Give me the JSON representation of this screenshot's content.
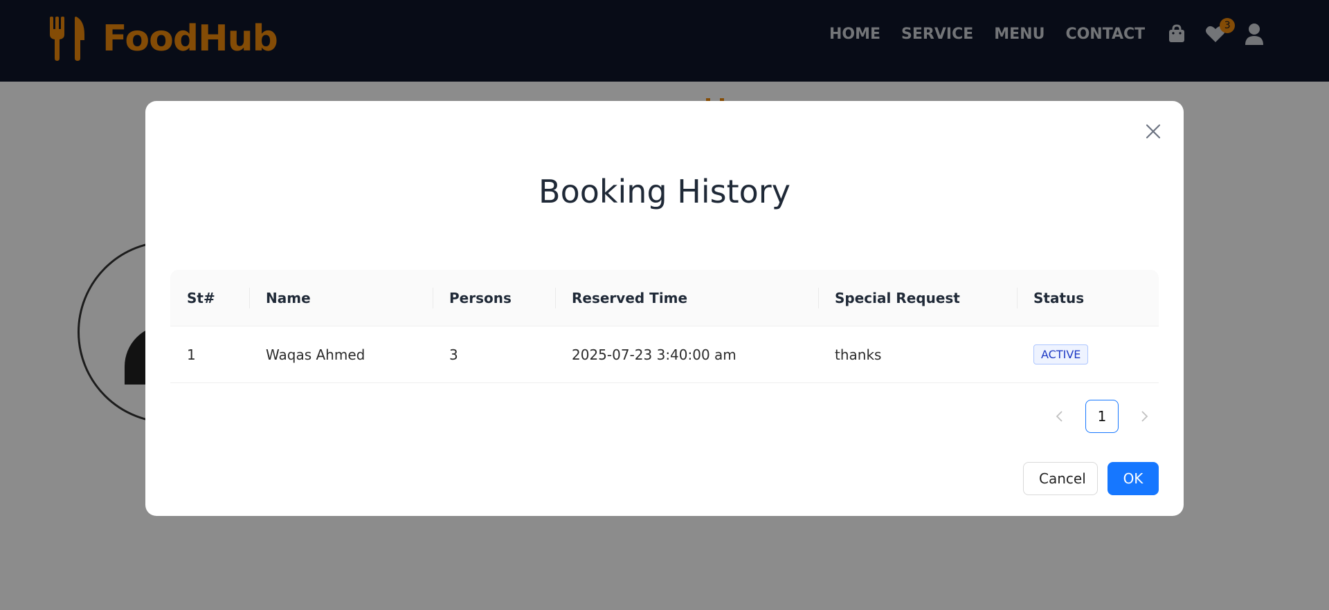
{
  "colors": {
    "navbar_bg": "#0f172a",
    "brand": "#f08a0b",
    "primary": "#1677ff",
    "status_active": "#1d39c4"
  },
  "navbar": {
    "brand_name": "FoodHub",
    "brand_icon": "utensils-icon",
    "links": [
      "HOME",
      "SERVICE",
      "MENU",
      "CONTACT"
    ],
    "cart_icon": "shopping-bag-icon",
    "wishlist_icon": "heart-icon",
    "wishlist_count": "3",
    "user_icon": "user-icon"
  },
  "modal": {
    "title": "Booking History",
    "close_icon": "close-icon",
    "table": {
      "columns": [
        "St#",
        "Name",
        "Persons",
        "Reserved Time",
        "Special Request",
        "Status"
      ],
      "rows": [
        {
          "st": "1",
          "name": "Waqas Ahmed",
          "persons": "3",
          "reserved_time": "2025-07-23 3:40:00 am",
          "special_request": "thanks",
          "status": "ACTIVE"
        }
      ]
    },
    "pagination": {
      "prev_icon": "chevron-left-icon",
      "current_page": "1",
      "next_icon": "chevron-right-icon"
    },
    "footer": {
      "cancel_label": "Cancel",
      "ok_label": "OK"
    }
  }
}
